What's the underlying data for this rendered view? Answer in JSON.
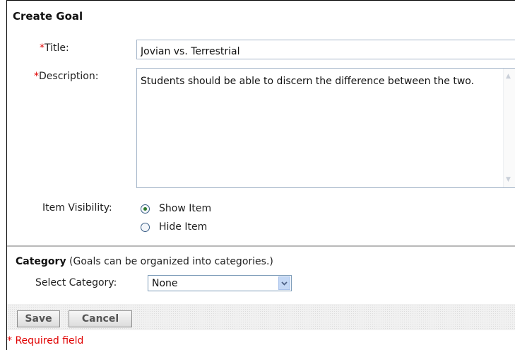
{
  "form": {
    "heading": "Create Goal",
    "required_marker": "*",
    "title_label": "Title:",
    "title_value": "Jovian vs. Terrestrial",
    "description_label": "Description:",
    "description_value": "Students should be able to discern the difference between the two.",
    "visibility_label": "Item Visibility:",
    "visibility_options": [
      {
        "label": "Show Item",
        "checked": true
      },
      {
        "label": "Hide Item",
        "checked": false
      }
    ]
  },
  "category": {
    "heading": "Category",
    "note": "(Goals can be organized into categories.)",
    "select_label": "Select Category:",
    "selected": "None"
  },
  "buttons": {
    "save": "Save",
    "cancel": "Cancel"
  },
  "footer": {
    "required_note": "* Required field"
  },
  "colors": {
    "required": "#e00000",
    "input_border": "#a7b7ca",
    "radio_dot": "#2c7a2c"
  }
}
